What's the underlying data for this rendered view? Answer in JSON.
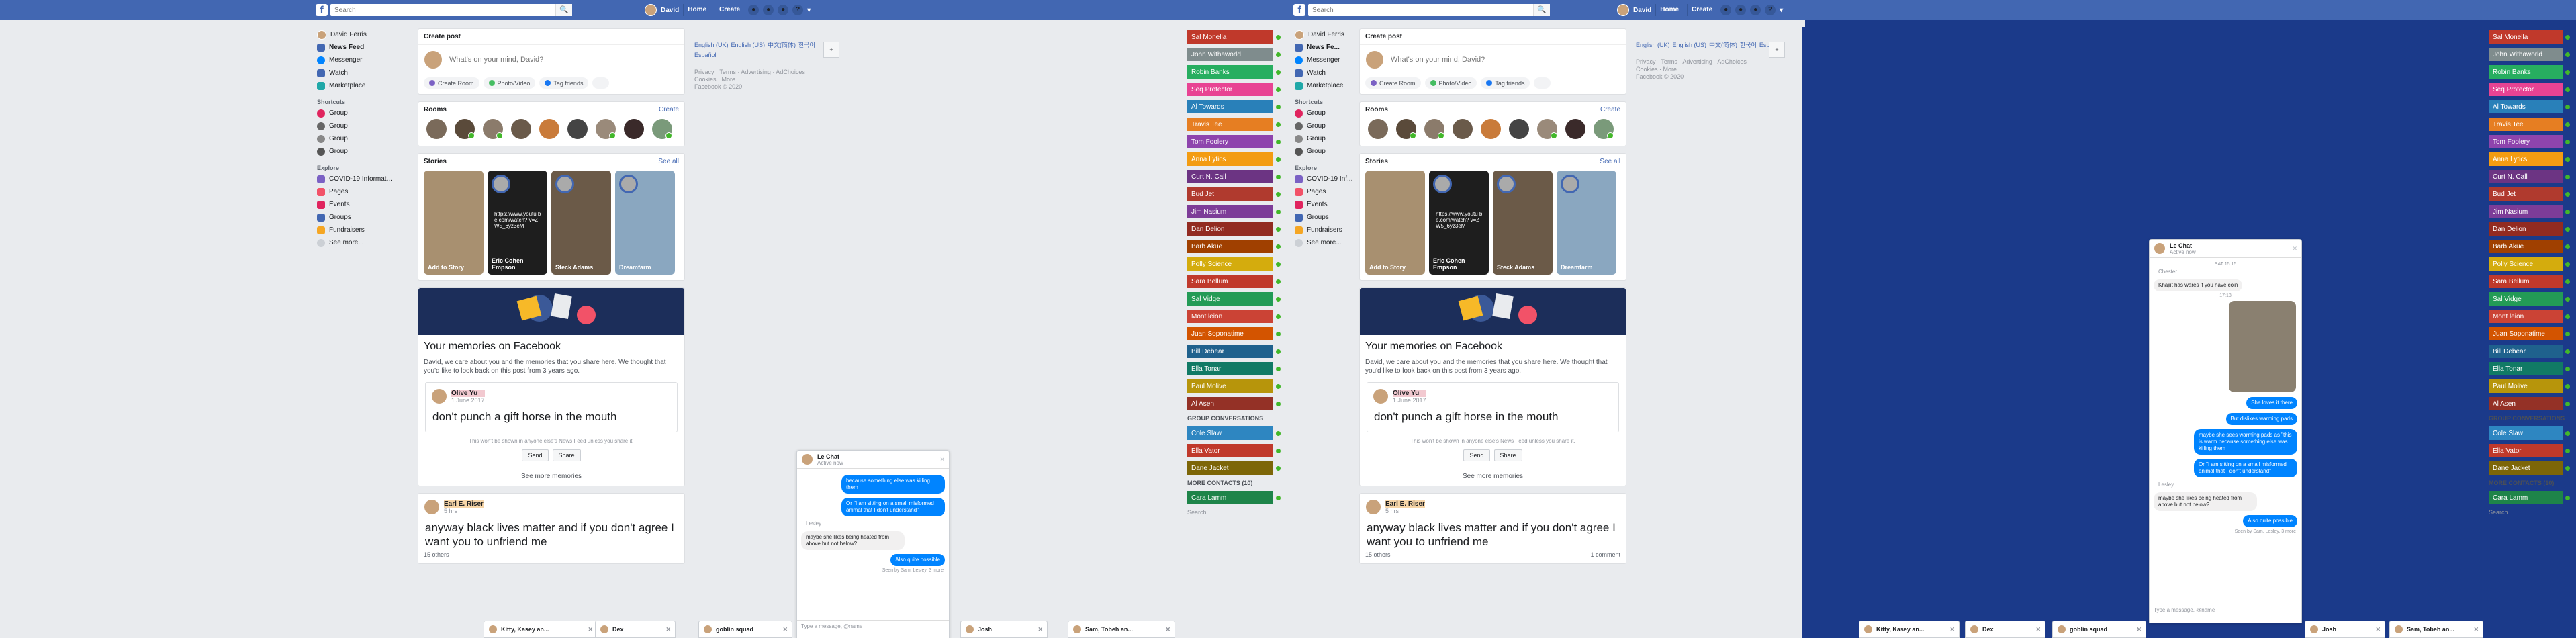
{
  "topbar": {
    "logo": "f",
    "search_placeholder": "Search",
    "user": "David",
    "links": [
      "Home",
      "Create"
    ]
  },
  "leftnav": {
    "profile": "David Ferris",
    "items": [
      {
        "label": "News Feed",
        "color": "#4267b2"
      },
      {
        "label": "Messenger",
        "color": "#0084ff"
      },
      {
        "label": "Watch",
        "color": "#4267b2"
      },
      {
        "label": "Marketplace",
        "color": "#20a8a8"
      }
    ],
    "shortcuts_label": "Shortcuts",
    "shortcuts": [
      "Group",
      "Group",
      "Group",
      "Group"
    ],
    "explore_label": "Explore",
    "explore": [
      {
        "label": "COVID-19 Informat...",
        "color": "#7b61c4"
      },
      {
        "label": "Pages",
        "color": "#f25268"
      },
      {
        "label": "Events",
        "color": "#e0245e"
      },
      {
        "label": "Groups",
        "color": "#4267b2"
      },
      {
        "label": "Fundraisers",
        "color": "#f5a623"
      }
    ],
    "see_more": "See more..."
  },
  "right_labels": {
    "news_feed_short": "News Fe...",
    "covid_short": "COVID-19 Inf..."
  },
  "composer": {
    "title": "Create post",
    "placeholder": "What's on your mind, David?",
    "actions": [
      "Create Room",
      "Photo/Video",
      "Tag friends"
    ]
  },
  "rooms": {
    "title": "Rooms",
    "action": "Create"
  },
  "stories": {
    "title": "Stories",
    "see_all": "See all",
    "items": [
      {
        "name": "Add to Story",
        "bg": "#a89070"
      },
      {
        "name": "Eric Cohen Empson",
        "bg": "#1e1e1e",
        "caption": "https://www.youtu be.com/watch? v=ZW5_6yz3eM"
      },
      {
        "name": "Steck Adams",
        "bg": "#6b5a48"
      },
      {
        "name": "Dreamfarm",
        "bg": "#8aa7c0"
      }
    ]
  },
  "memory": {
    "title": "Your memories on Facebook",
    "sub": "David, we care about you and the memories that you share here. We thought that you'd like to look back on this post from 3 years ago.",
    "poster": "Olive Yu",
    "date": "1 June 2017",
    "text": "don't punch a gift horse in the mouth",
    "note": "This won't be shown in anyone else's News Feed unless you share it.",
    "send": "Send",
    "share": "Share",
    "more": "See more memories"
  },
  "post2": {
    "poster": "Earl E. Riser",
    "date": "5 hrs",
    "text": "anyway black lives matter and if you don't agree I want you to unfriend me",
    "reactions": "15 others",
    "comments": "1 comment"
  },
  "sidebar_right": {
    "langs": [
      "English (UK)",
      "English (US)",
      "中文(简体)",
      "한국어",
      "Español"
    ],
    "footer1": "Privacy · Terms · Advertising · AdChoices",
    "footer2": "Cookies · More",
    "copyright": "Facebook © 2020"
  },
  "contacts": [
    {
      "name": "Sal Monella",
      "color": "#c0392b"
    },
    {
      "name": "John Withaworld",
      "color": "#7f8c8d"
    },
    {
      "name": "Robin Banks",
      "color": "#27ae60"
    },
    {
      "name": "Seq Protector",
      "color": "#e84393"
    },
    {
      "name": "Al Towards",
      "color": "#2980b9"
    },
    {
      "name": "Travis Tee",
      "color": "#e67e22"
    },
    {
      "name": "Tom Foolery",
      "color": "#8e44ad"
    },
    {
      "name": "Anna Lytics",
      "color": "#f39c12"
    },
    {
      "name": "Curt N. Call",
      "color": "#6c3483"
    },
    {
      "name": "Bud Jet",
      "color": "#b03a2e"
    },
    {
      "name": "Jim Nasium",
      "color": "#7d3c98"
    },
    {
      "name": "Dan Delion",
      "color": "#922b21"
    },
    {
      "name": "Barb Akue",
      "color": "#a04000"
    },
    {
      "name": "Polly Science",
      "color": "#d4ac0d"
    },
    {
      "name": "Sara Bellum",
      "color": "#c0392b"
    },
    {
      "name": "Sal Vidge",
      "color": "#239b56"
    },
    {
      "name": "Mont leion",
      "color": "#cb4335"
    },
    {
      "name": "Juan Soponatime",
      "color": "#d35400"
    },
    {
      "name": "Bill Debear",
      "color": "#1f618d"
    },
    {
      "name": "Ella Tonar",
      "color": "#117a65"
    },
    {
      "name": "Paul Molive",
      "color": "#b7950b"
    },
    {
      "name": "Al Asen",
      "color": "#943126"
    }
  ],
  "group_convs_label": "GROUP CONVERSATIONS",
  "groups": [
    {
      "name": "Cole Slaw",
      "color": "#2e86c1"
    },
    {
      "name": "Ella Vator",
      "color": "#c0392b"
    },
    {
      "name": "Dane Jacket",
      "color": "#7d6608"
    }
  ],
  "more_contacts": "MORE CONTACTS (10)",
  "last_contact": {
    "name": "Cara Lamm",
    "color": "#1e8449"
  },
  "search_contacts": "Search",
  "chat": {
    "title": "Le Chat",
    "status": "Active now",
    "msgs": [
      {
        "from": "me",
        "text": "because something else was killing them"
      },
      {
        "from": "me",
        "text": "Or \"I am sitting on a small misformed animal that I don't understand\""
      },
      {
        "from": "them",
        "text": "Lesley"
      },
      {
        "from": "them",
        "text": "maybe she likes being heated from above but not below?"
      },
      {
        "from": "me",
        "text": "Also quite possible"
      }
    ],
    "seen": "Seen by Sam, Lesley, 3 more",
    "input": "Type a message, @name",
    "msgs_r": [
      {
        "from": "them",
        "text": "Chester"
      },
      {
        "from": "them",
        "text": "Khajiit has wares if you have coin"
      },
      {
        "from": "me",
        "text": "She loves it there"
      },
      {
        "from": "me",
        "text": "But dislikes warming pads"
      },
      {
        "from": "me",
        "text": "maybe she sees warming pads as \"this is warm because something else was killing them"
      },
      {
        "from": "me",
        "text": "Or \"I am sitting on a small misformed animal that I don't understand\""
      },
      {
        "from": "them",
        "text": "Lesley"
      },
      {
        "from": "them",
        "text": "maybe she likes being heated from above but not below?"
      },
      {
        "from": "me",
        "text": "Also quite possible"
      }
    ],
    "time1": "SAT 15:15",
    "time2": "17:18"
  },
  "tabs": [
    "Kitty, Kasey an...",
    "Dex",
    "goblin squad",
    "Josh",
    "Sam, Tobeh an..."
  ]
}
